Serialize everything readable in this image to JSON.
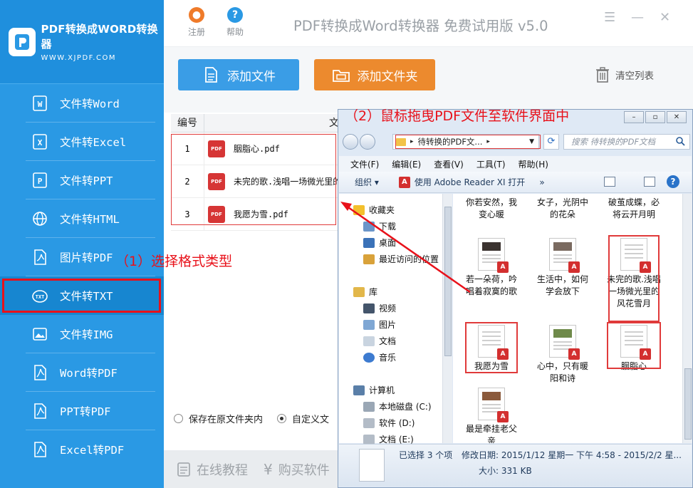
{
  "brand": {
    "name": "PDF转换成WORD转换器",
    "url": "WWW.XJPDF.COM"
  },
  "sidebar": {
    "items": [
      {
        "label": "文件转Word",
        "icon": "word-icon"
      },
      {
        "label": "文件转Excel",
        "icon": "excel-icon"
      },
      {
        "label": "文件转PPT",
        "icon": "ppt-icon"
      },
      {
        "label": "文件转HTML",
        "icon": "globe-icon"
      },
      {
        "label": "图片转PDF",
        "icon": "image-pdf-icon"
      },
      {
        "label": "文件转TXT",
        "icon": "txt-icon",
        "active": true
      },
      {
        "label": "文件转IMG",
        "icon": "image-icon"
      },
      {
        "label": "Word转PDF",
        "icon": "pdf-icon"
      },
      {
        "label": "PPT转PDF",
        "icon": "pdf-icon"
      },
      {
        "label": "Excel转PDF",
        "icon": "pdf-icon"
      }
    ]
  },
  "titlebar": {
    "register": "注册",
    "help": "帮助",
    "title": "PDF转换成Word转换器 免费试用版 v5.0"
  },
  "toolbar": {
    "add_file": "添加文件",
    "add_folder": "添加文件夹",
    "clear_list": "清空列表"
  },
  "table": {
    "col_num": "编号",
    "col_name": "文件名称",
    "rows": [
      {
        "num": "1",
        "name": "胭脂心.pdf"
      },
      {
        "num": "2",
        "name": "未完的歌.浅唱一场微光里的"
      },
      {
        "num": "3",
        "name": "我愿为雪.pdf"
      }
    ]
  },
  "save_options": {
    "original": "保存在原文件夹内",
    "custom": "自定义文"
  },
  "bottom": {
    "online_tutorial": "在线教程",
    "buy": "购买软件"
  },
  "annotations": {
    "step1": "（1）选择格式类型",
    "step2": "（2）鼠标拖曳PDF文件至软件界面中"
  },
  "explorer": {
    "address": "待转换的PDF文...",
    "search_placeholder": "搜索 待转换的PDF文档",
    "menu": [
      "文件(F)",
      "编辑(E)",
      "查看(V)",
      "工具(T)",
      "帮助(H)"
    ],
    "cmd_organize": "组织",
    "cmd_open": "使用 Adobe Reader XI 打开",
    "cmd_more": "»",
    "tree": {
      "favorites": "收藏夹",
      "downloads": "下载",
      "desktop": "桌面",
      "recent": "最近访问的位置",
      "libraries": "库",
      "videos": "视频",
      "pictures": "图片",
      "documents": "文档",
      "music": "音乐",
      "computer": "计算机",
      "drive_c": "本地磁盘 (C:)",
      "drive_d": "软件 (D:)",
      "drive_e": "文档 (E:)"
    },
    "files": [
      {
        "name": "你若安然，我变心暖"
      },
      {
        "name": "女子，光阴中的花朵"
      },
      {
        "name": "破茧成蝶，必将云开月明"
      },
      {
        "name": "若一朵荷，吟唱着寂寞的歌"
      },
      {
        "name": "生活中，如何学会放下"
      },
      {
        "name": "未完的歌.浅唱一场微光里的风花雪月"
      },
      {
        "name": "我愿为雪"
      },
      {
        "name": "心中，只有暖阳和诗"
      },
      {
        "name": "胭脂心"
      },
      {
        "name": "最是牵挂老父亲"
      }
    ],
    "details": {
      "selected": "已选择 3 个项",
      "modified": "修改日期: 2015/1/12 星期一 下午 4:58 - 2015/2/2 星...",
      "size": "大小: 331 KB"
    }
  },
  "colors": {
    "sidebar": "#2a99e4",
    "add_file_btn": "#3a9de6",
    "add_folder_btn": "#ec8a2e",
    "annotation": "#e8111a"
  }
}
